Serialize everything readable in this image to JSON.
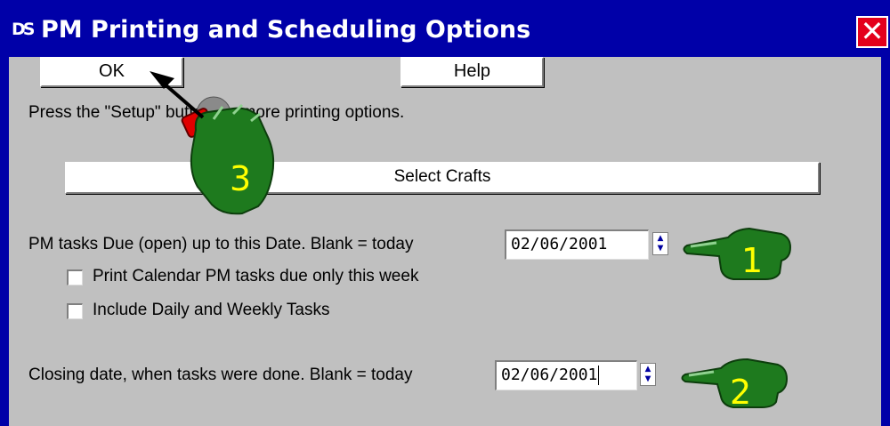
{
  "window": {
    "title": "PM Printing and Scheduling Options",
    "icon": "app-icon",
    "close_glyph": "✕"
  },
  "buttons": {
    "ok": "OK",
    "help": "Help",
    "select_crafts": "Select Crafts"
  },
  "setup_hint": "Press the \"Setup\" button for more printing options.",
  "due_date": {
    "label": "PM tasks Due (open) up to this Date.  Blank = today",
    "value": "02/06/2001"
  },
  "options": {
    "calendar_week": {
      "label": "Print Calendar PM tasks due only this week",
      "checked": false
    },
    "daily_weekly": {
      "label": "Include Daily and Weekly Tasks",
      "checked": false
    }
  },
  "closing_date": {
    "label": "Closing date, when tasks were done.  Blank = today",
    "value": "02/06/2001"
  },
  "callouts": {
    "one": "1",
    "two": "2",
    "three": "3"
  },
  "colors": {
    "title_bar": "#0000a8",
    "dialog_bg": "#c0c0c0",
    "callout_green": "#1e7a1e",
    "callout_number": "#ffff00",
    "close_red": "#e4001b"
  }
}
